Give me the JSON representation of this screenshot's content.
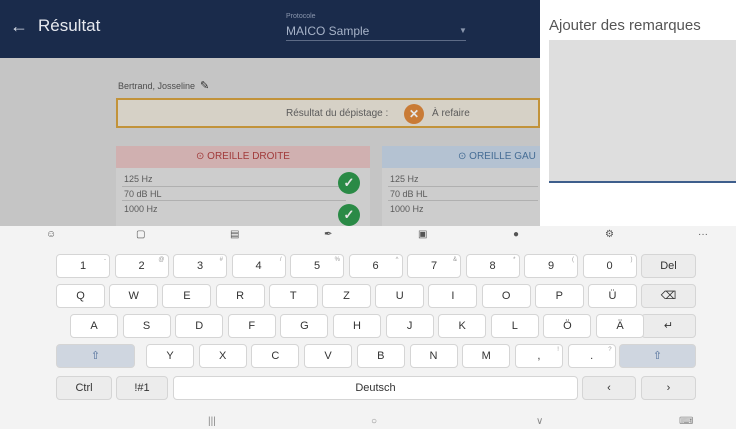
{
  "app": {
    "title": "Résultat",
    "protocol_label": "Protocole",
    "protocol_value": "MAICO Sample",
    "patient_name": "Bertrand, Josseline",
    "screening_label": "Résultat du dépistage :",
    "screening_result": "À refaire",
    "ear_right": {
      "title": "OREILLE DROITE",
      "rows": [
        "125 Hz",
        "70 dB HL",
        "1000 Hz"
      ]
    },
    "ear_left": {
      "title": "OREILLE GAU",
      "rows": [
        "125 Hz",
        "70 dB HL",
        "1000 Hz"
      ]
    }
  },
  "remarks": {
    "title": "Ajouter des remarques"
  },
  "keyboard": {
    "toolbar_icons": [
      "emoji-icon",
      "sticker-icon",
      "gif-icon",
      "handwriting-icon",
      "clipboard-icon",
      "microphone-icon",
      "settings-icon",
      "more-icon"
    ],
    "row1": [
      "1",
      "2",
      "3",
      "4",
      "5",
      "6",
      "7",
      "8",
      "9",
      "0"
    ],
    "row1_sub": [
      "-",
      "@",
      "#",
      "/",
      "%",
      "^",
      "&",
      "*",
      "(",
      ")"
    ],
    "del_label": "Del",
    "row2": [
      "Q",
      "W",
      "E",
      "R",
      "T",
      "Z",
      "U",
      "I",
      "O",
      "P",
      "Ü"
    ],
    "row3": [
      "A",
      "S",
      "D",
      "F",
      "G",
      "H",
      "J",
      "K",
      "L",
      "Ö",
      "Ä"
    ],
    "row4": [
      "Y",
      "X",
      "C",
      "V",
      "B",
      "N",
      "M",
      ",",
      "."
    ],
    "row4_sub": [
      "",
      "",
      "",
      "",
      "",
      "",
      "",
      "!",
      "?"
    ],
    "ctrl_label": "Ctrl",
    "sym_label": "!#1",
    "space_label": "Deutsch",
    "more_label": "···",
    "nav_back": "|||",
    "nav_home": "○",
    "nav_down": "∨",
    "nav_kbd": "⌨"
  }
}
